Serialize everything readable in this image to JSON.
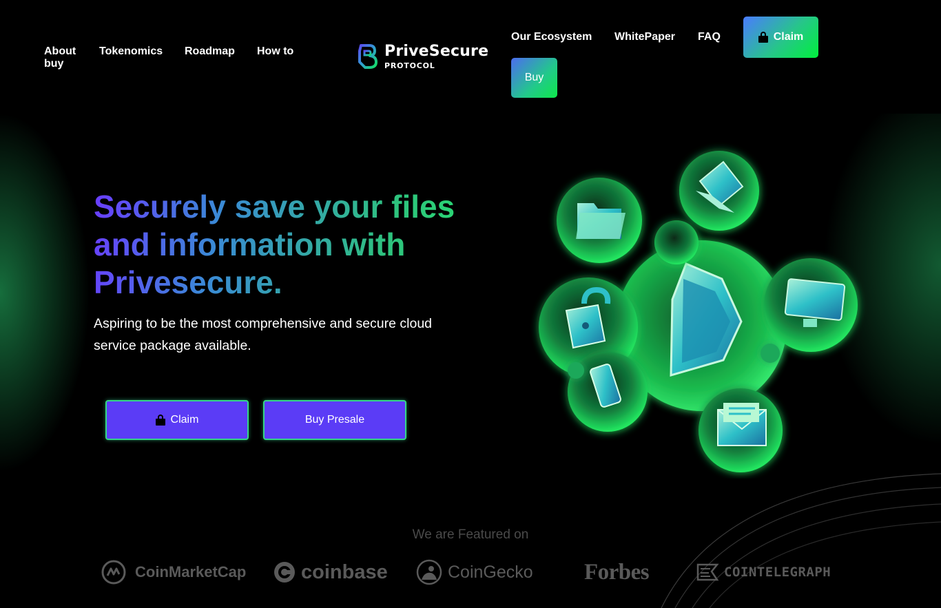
{
  "nav": {
    "about": "About",
    "how_to_buy": "How to buy",
    "tokenomics": "Tokenomics",
    "roadmap": "Roadmap",
    "our_ecosystem": "Our Ecosystem",
    "whitepaper": "WhitePaper",
    "faq": "FAQ",
    "claim": "Claim",
    "buy": "Buy"
  },
  "logo": {
    "name": "PriveSecure",
    "sub": "PROTOCOL"
  },
  "hero": {
    "title": "Securely save your files and information with Privesecure.",
    "subtitle": "Aspiring to be the most comprehensive and secure cloud service package available.",
    "claim_button": "Claim",
    "buy_presale_button": "Buy Presale"
  },
  "featured": {
    "title": "We are Featured on",
    "brands": [
      "CoinMarketCap",
      "coinbase",
      "CoinGecko",
      "Forbes",
      "COINTELEGRAPH"
    ]
  },
  "colors": {
    "accent_green": "#00f03c",
    "accent_purple": "#5b3cf6",
    "background": "#000000"
  }
}
